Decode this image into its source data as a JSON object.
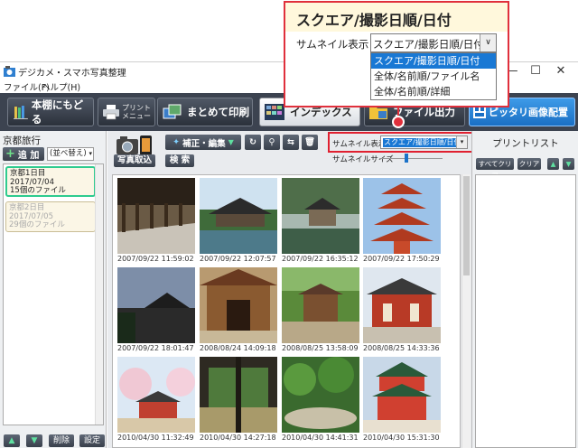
{
  "window": {
    "title": "デジカメ・スマホ写真整理",
    "menus": [
      "ファイル(F)",
      "ヘルプ(H)"
    ]
  },
  "toolbar": {
    "back_label": "本棚にもどる",
    "print_menu_label": "プリント\nメニュー",
    "bulk_print_label": "まとめて印刷",
    "index_label": "インデックス",
    "file_output_label": "ファイル出力",
    "fit_layout_label": "ピッタリ画像配置"
  },
  "left_panel": {
    "album_title": "京都旅行",
    "add_label": "追 加",
    "sort_label": "(並べ替え)",
    "albums": [
      {
        "name": "京都1日目",
        "date": "2017/07/04",
        "count": "15個のファイル"
      },
      {
        "name": "京都2日目",
        "date": "2017/07/05",
        "count": "29個のファイル"
      }
    ],
    "delete_label": "削除",
    "settings_label": "設定"
  },
  "center": {
    "import_label": "写真取込",
    "edit_label": "補正・編集",
    "search_label": "検 索",
    "thumb_display_label": "サムネイル表示",
    "thumb_display_value": "スクエア/撮影日順/日付",
    "thumb_size_label": "サムネイルサイズ",
    "thumbnails": [
      {
        "caption": "2007/09/22 11:59:02",
        "kind": "corridor"
      },
      {
        "caption": "2007/09/22 12:07:57",
        "kind": "pond-temple"
      },
      {
        "caption": "2007/09/22 16:35:12",
        "kind": "silver-pavilion"
      },
      {
        "caption": "2007/09/22 17:50:29",
        "kind": "red-pagoda"
      },
      {
        "caption": "2007/09/22 18:01:47",
        "kind": "dusk-temple"
      },
      {
        "caption": "2008/08/24 14:09:18",
        "kind": "gate"
      },
      {
        "caption": "2008/08/25 13:58:09",
        "kind": "green-gate"
      },
      {
        "caption": "2008/08/25 14:33:36",
        "kind": "red-hall"
      },
      {
        "caption": "2010/04/30 11:32:49",
        "kind": "cherry-hall"
      },
      {
        "caption": "2010/04/30 14:27:18",
        "kind": "tatami"
      },
      {
        "caption": "2010/04/30 14:41:31",
        "kind": "garden"
      },
      {
        "caption": "2010/04/30 15:31:30",
        "kind": "red-tower"
      }
    ]
  },
  "print_list": {
    "title": "プリントリスト",
    "clear_all_label": "すべてクリア",
    "clear_label": "クリア"
  },
  "callout": {
    "heading": "スクエア/撮影日順/日付",
    "label": "サムネイル表示",
    "current": "スクエア/撮影日順/日付",
    "options": [
      "スクエア/撮影日順/日付",
      "全体/名前順/ファイル名",
      "全体/名前順/詳細"
    ],
    "selected_index": 0
  },
  "colors": {
    "toolbar_bg": "#3c4350",
    "accent_blue": "#1978d4",
    "highlight_red": "#e0303c",
    "selected_album_border": "#2ecb8f"
  }
}
